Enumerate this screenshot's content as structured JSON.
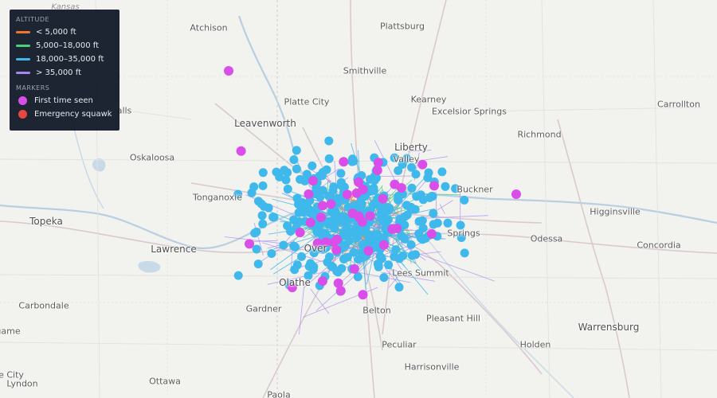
{
  "legend": {
    "altitude_title": "ALTITUDE",
    "altitude": [
      {
        "label": "< 5,000 ft",
        "color": "#f0762f"
      },
      {
        "label": "5,000–18,000 ft",
        "color": "#4ad07c"
      },
      {
        "label": "18,000–35,000 ft",
        "color": "#3fb8ec"
      },
      {
        "label": "> 35,000 ft",
        "color": "#a685f0"
      }
    ],
    "markers_title": "MARKERS",
    "markers": [
      {
        "label": "First time seen",
        "color": "#d94ee8"
      },
      {
        "label": "Emergency squawk",
        "color": "#e8473f"
      }
    ]
  },
  "places": {
    "kansas": "Kansas",
    "atchison": "Atchison",
    "plattsburg": "Plattsburg",
    "smithville": "Smithville",
    "platte_city": "Platte City",
    "kearney": "Kearney",
    "excelsior_springs": "Excelsior Springs",
    "carrollton": "Carrollton",
    "richmond": "Richmond",
    "leavenworth": "Leavenworth",
    "liberty": "Liberty",
    "oskaloosa": "Oskaloosa",
    "tonganoxie": "Tonganoxie",
    "buckner": "Buckner",
    "higginsville": "Higginsville",
    "topeka": "Topeka",
    "odessa": "Odessa",
    "lawrence": "Lawrence",
    "concordia": "Concordia",
    "carbondale": "Carbondale",
    "pleasant_hill": "Pleasant Hill",
    "warrensburg": "Warrensburg",
    "gardner": "Gardner",
    "peculiar": "Peculiar",
    "holden": "Holden",
    "harrisonville": "Harrisonville",
    "ottawa": "Ottawa",
    "lyndon": "Lyndon",
    "city_partial": "e City",
    "olathe_partial": "Olathe",
    "overland_partial": "Over",
    "springs_partial": "Springs",
    "belton_partial": "Belton",
    "valley_partial": "Valley",
    "lees_partial": "Lees Summit",
    "paola_partial": "Paola",
    "game_partial": "game",
    "falls_partial": "alls"
  }
}
